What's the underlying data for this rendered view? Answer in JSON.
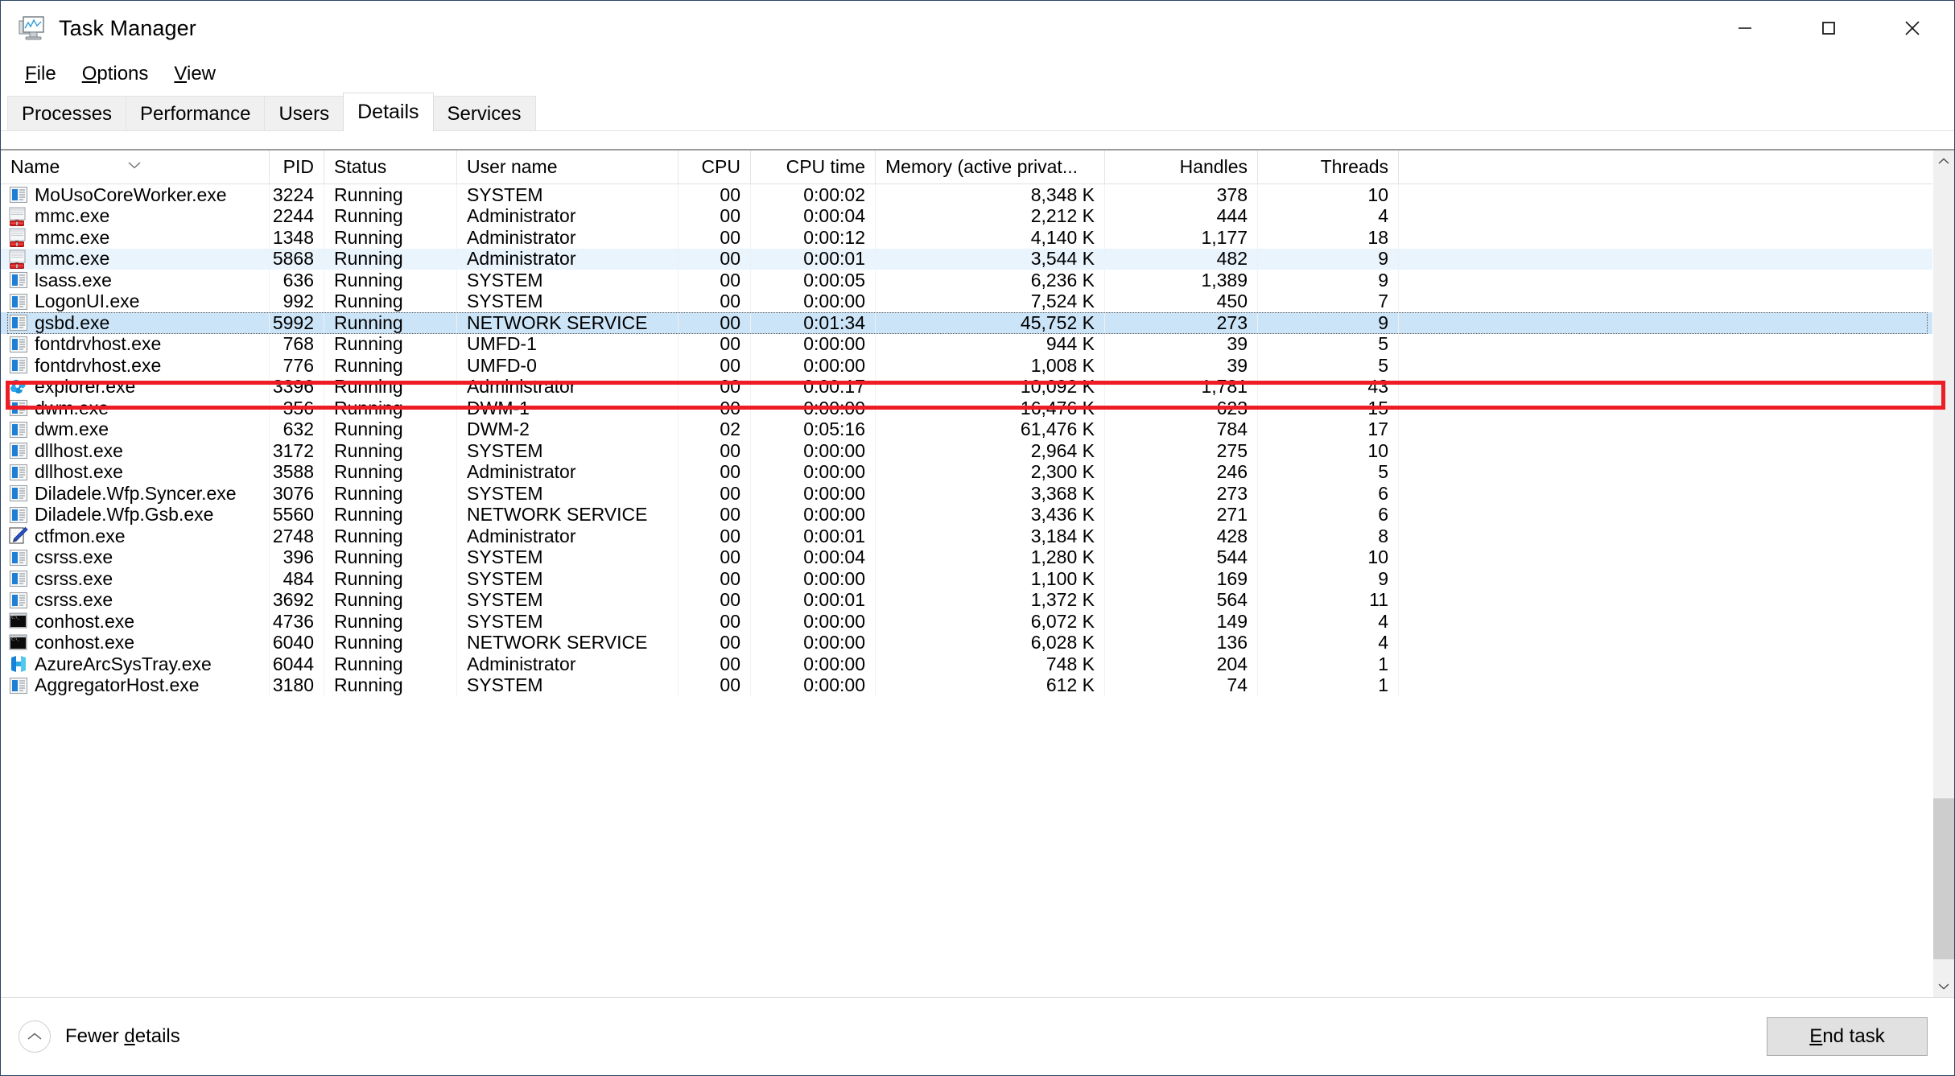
{
  "window": {
    "title": "Task Manager",
    "title_icon": "task-manager-icon",
    "controls": {
      "minimize": "minimize-icon",
      "maximize": "maximize-icon",
      "close": "close-icon"
    }
  },
  "menu": [
    {
      "label": "File",
      "accel": "F"
    },
    {
      "label": "Options",
      "accel": "O"
    },
    {
      "label": "View",
      "accel": "V"
    }
  ],
  "tabs": [
    {
      "label": "Processes",
      "active": false
    },
    {
      "label": "Performance",
      "active": false
    },
    {
      "label": "Users",
      "active": false
    },
    {
      "label": "Details",
      "active": true
    },
    {
      "label": "Services",
      "active": false
    }
  ],
  "table": {
    "sort_indicator": "chevron-down-icon",
    "sorted_column": "Name",
    "columns": [
      {
        "key": "name",
        "label": "Name",
        "align": "left"
      },
      {
        "key": "pid",
        "label": "PID",
        "align": "right"
      },
      {
        "key": "status",
        "label": "Status",
        "align": "left"
      },
      {
        "key": "user",
        "label": "User name",
        "align": "left"
      },
      {
        "key": "cpu",
        "label": "CPU",
        "align": "right"
      },
      {
        "key": "cputime",
        "label": "CPU time",
        "align": "right"
      },
      {
        "key": "memory",
        "label": "Memory (active privat...",
        "align": "right"
      },
      {
        "key": "handles",
        "label": "Handles",
        "align": "right"
      },
      {
        "key": "threads",
        "label": "Threads",
        "align": "right"
      }
    ],
    "rows": [
      {
        "icon": "app-window-icon",
        "name": "MoUsoCoreWorker.exe",
        "pid": "3224",
        "status": "Running",
        "user": "SYSTEM",
        "cpu": "00",
        "cputime": "0:00:02",
        "memory": "8,348 K",
        "handles": "378",
        "threads": "10",
        "state": "normal"
      },
      {
        "icon": "mmc-toolbox-icon",
        "name": "mmc.exe",
        "pid": "2244",
        "status": "Running",
        "user": "Administrator",
        "cpu": "00",
        "cputime": "0:00:04",
        "memory": "2,212 K",
        "handles": "444",
        "threads": "4",
        "state": "normal"
      },
      {
        "icon": "mmc-toolbox-icon",
        "name": "mmc.exe",
        "pid": "1348",
        "status": "Running",
        "user": "Administrator",
        "cpu": "00",
        "cputime": "0:00:12",
        "memory": "4,140 K",
        "handles": "1,177",
        "threads": "18",
        "state": "normal"
      },
      {
        "icon": "mmc-toolbox-icon",
        "name": "mmc.exe",
        "pid": "5868",
        "status": "Running",
        "user": "Administrator",
        "cpu": "00",
        "cputime": "0:00:01",
        "memory": "3,544 K",
        "handles": "482",
        "threads": "9",
        "state": "alt"
      },
      {
        "icon": "app-window-icon",
        "name": "lsass.exe",
        "pid": "636",
        "status": "Running",
        "user": "SYSTEM",
        "cpu": "00",
        "cputime": "0:00:05",
        "memory": "6,236 K",
        "handles": "1,389",
        "threads": "9",
        "state": "normal"
      },
      {
        "icon": "app-window-icon",
        "name": "LogonUI.exe",
        "pid": "992",
        "status": "Running",
        "user": "SYSTEM",
        "cpu": "00",
        "cputime": "0:00:00",
        "memory": "7,524 K",
        "handles": "450",
        "threads": "7",
        "state": "normal"
      },
      {
        "icon": "app-window-icon",
        "name": "gsbd.exe",
        "pid": "5992",
        "status": "Running",
        "user": "NETWORK SERVICE",
        "cpu": "00",
        "cputime": "0:01:34",
        "memory": "45,752 K",
        "handles": "273",
        "threads": "9",
        "state": "selected"
      },
      {
        "icon": "app-window-icon",
        "name": "fontdrvhost.exe",
        "pid": "768",
        "status": "Running",
        "user": "UMFD-1",
        "cpu": "00",
        "cputime": "0:00:00",
        "memory": "944 K",
        "handles": "39",
        "threads": "5",
        "state": "normal"
      },
      {
        "icon": "app-window-icon",
        "name": "fontdrvhost.exe",
        "pid": "776",
        "status": "Running",
        "user": "UMFD-0",
        "cpu": "00",
        "cputime": "0:00:00",
        "memory": "1,008 K",
        "handles": "39",
        "threads": "5",
        "state": "normal"
      },
      {
        "icon": "explorer-icon",
        "name": "explorer.exe",
        "pid": "3396",
        "status": "Running",
        "user": "Administrator",
        "cpu": "00",
        "cputime": "0:00:17",
        "memory": "10,092 K",
        "handles": "1,781",
        "threads": "43",
        "state": "normal"
      },
      {
        "icon": "app-window-icon",
        "name": "dwm.exe",
        "pid": "356",
        "status": "Running",
        "user": "DWM-1",
        "cpu": "00",
        "cputime": "0:00:00",
        "memory": "16,476 K",
        "handles": "623",
        "threads": "15",
        "state": "normal"
      },
      {
        "icon": "app-window-icon",
        "name": "dwm.exe",
        "pid": "632",
        "status": "Running",
        "user": "DWM-2",
        "cpu": "02",
        "cputime": "0:05:16",
        "memory": "61,476 K",
        "handles": "784",
        "threads": "17",
        "state": "normal"
      },
      {
        "icon": "app-window-icon",
        "name": "dllhost.exe",
        "pid": "3172",
        "status": "Running",
        "user": "SYSTEM",
        "cpu": "00",
        "cputime": "0:00:00",
        "memory": "2,964 K",
        "handles": "275",
        "threads": "10",
        "state": "normal"
      },
      {
        "icon": "app-window-icon",
        "name": "dllhost.exe",
        "pid": "3588",
        "status": "Running",
        "user": "Administrator",
        "cpu": "00",
        "cputime": "0:00:00",
        "memory": "2,300 K",
        "handles": "246",
        "threads": "5",
        "state": "normal"
      },
      {
        "icon": "app-window-icon",
        "name": "Diladele.Wfp.Syncer.exe",
        "pid": "3076",
        "status": "Running",
        "user": "SYSTEM",
        "cpu": "00",
        "cputime": "0:00:00",
        "memory": "3,368 K",
        "handles": "273",
        "threads": "6",
        "state": "normal"
      },
      {
        "icon": "app-window-icon",
        "name": "Diladele.Wfp.Gsb.exe",
        "pid": "5560",
        "status": "Running",
        "user": "NETWORK SERVICE",
        "cpu": "00",
        "cputime": "0:00:00",
        "memory": "3,436 K",
        "handles": "271",
        "threads": "6",
        "state": "normal"
      },
      {
        "icon": "ctfmon-pen-icon",
        "name": "ctfmon.exe",
        "pid": "2748",
        "status": "Running",
        "user": "Administrator",
        "cpu": "00",
        "cputime": "0:00:01",
        "memory": "3,184 K",
        "handles": "428",
        "threads": "8",
        "state": "normal"
      },
      {
        "icon": "app-window-icon",
        "name": "csrss.exe",
        "pid": "396",
        "status": "Running",
        "user": "SYSTEM",
        "cpu": "00",
        "cputime": "0:00:04",
        "memory": "1,280 K",
        "handles": "544",
        "threads": "10",
        "state": "normal"
      },
      {
        "icon": "app-window-icon",
        "name": "csrss.exe",
        "pid": "484",
        "status": "Running",
        "user": "SYSTEM",
        "cpu": "00",
        "cputime": "0:00:00",
        "memory": "1,100 K",
        "handles": "169",
        "threads": "9",
        "state": "normal"
      },
      {
        "icon": "app-window-icon",
        "name": "csrss.exe",
        "pid": "3692",
        "status": "Running",
        "user": "SYSTEM",
        "cpu": "00",
        "cputime": "0:00:01",
        "memory": "1,372 K",
        "handles": "564",
        "threads": "11",
        "state": "normal"
      },
      {
        "icon": "console-icon",
        "name": "conhost.exe",
        "pid": "4736",
        "status": "Running",
        "user": "SYSTEM",
        "cpu": "00",
        "cputime": "0:00:00",
        "memory": "6,072 K",
        "handles": "149",
        "threads": "4",
        "state": "normal"
      },
      {
        "icon": "console-icon",
        "name": "conhost.exe",
        "pid": "6040",
        "status": "Running",
        "user": "NETWORK SERVICE",
        "cpu": "00",
        "cputime": "0:00:00",
        "memory": "6,028 K",
        "handles": "136",
        "threads": "4",
        "state": "normal"
      },
      {
        "icon": "azure-arc-icon",
        "name": "AzureArcSysTray.exe",
        "pid": "6044",
        "status": "Running",
        "user": "Administrator",
        "cpu": "00",
        "cputime": "0:00:00",
        "memory": "748 K",
        "handles": "204",
        "threads": "1",
        "state": "normal"
      },
      {
        "icon": "app-window-icon",
        "name": "AggregatorHost.exe",
        "pid": "3180",
        "status": "Running",
        "user": "SYSTEM",
        "cpu": "00",
        "cputime": "0:00:00",
        "memory": "612 K",
        "handles": "74",
        "threads": "1",
        "state": "normal"
      }
    ]
  },
  "scrollbar": {
    "up": "scroll-up-icon",
    "down": "scroll-down-icon"
  },
  "statusbar": {
    "fewer_details": "Fewer details",
    "fewer_details_accel": "d",
    "fewer_details_icon": "chevron-up-icon",
    "end_task": "End task",
    "end_task_accel": "E"
  },
  "annotation": {
    "type": "red-rectangle-highlight",
    "target_row": "gsbd.exe",
    "color": "#ee1c25"
  }
}
